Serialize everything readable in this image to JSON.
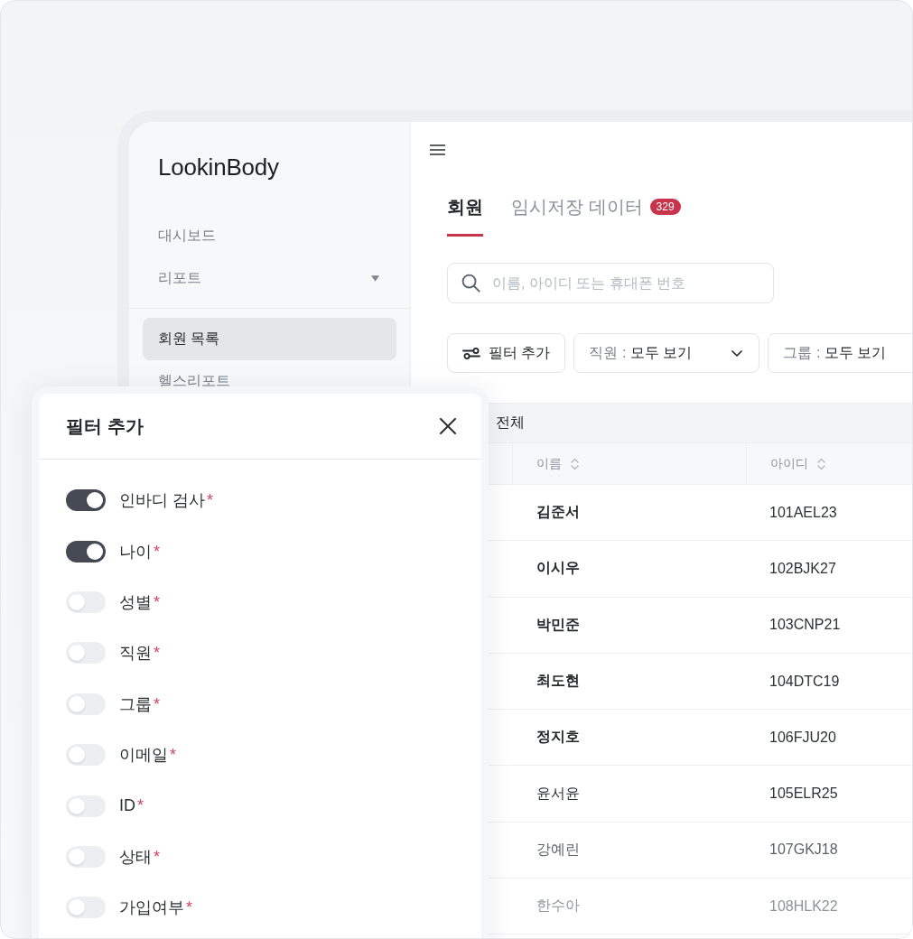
{
  "sidebar": {
    "logo": "LookinBody",
    "items": [
      {
        "label": "대시보드",
        "kind": "link",
        "selected": false
      },
      {
        "label": "리포트",
        "kind": "group",
        "selected": false
      }
    ],
    "sub_items": [
      {
        "label": "회원 목록",
        "selected": true
      },
      {
        "label": "헬스리포트",
        "selected": false
      }
    ]
  },
  "tabs": [
    {
      "label": "회원",
      "selected": true
    },
    {
      "label": "임시저장 데이터",
      "selected": false,
      "badge": "329"
    }
  ],
  "search": {
    "placeholder": "이름, 아이디 또는 휴대폰 번호"
  },
  "filter_bar": {
    "add_button": "필터 추가",
    "dropdowns": [
      {
        "label": "직원 :",
        "value": "모두 보기"
      },
      {
        "label": "그룹 :",
        "value": "모두 보기"
      }
    ]
  },
  "table": {
    "summary": "전체",
    "columns": [
      "이름",
      "아이디"
    ],
    "rows": [
      {
        "name": "김준서",
        "id": "101AEL23",
        "bold": true
      },
      {
        "name": "이시우",
        "id": "102BJK27",
        "bold": true
      },
      {
        "name": "박민준",
        "id": "103CNP21",
        "bold": true
      },
      {
        "name": "최도현",
        "id": "104DTC19",
        "bold": true
      },
      {
        "name": "정지호",
        "id": "106FJU20",
        "bold": true
      },
      {
        "name": "윤서윤",
        "id": "105ELR25",
        "bold": false
      },
      {
        "name": "강예린",
        "id": "107GKJ18",
        "bold": false
      },
      {
        "name": "한수아",
        "id": "108HLK22",
        "bold": false
      }
    ]
  },
  "filter_panel": {
    "title": "필터 추가",
    "items": [
      {
        "label": "인바디 검사",
        "required_mark": "*",
        "on": true
      },
      {
        "label": "나이",
        "required_mark": "*",
        "on": true
      },
      {
        "label": "성별",
        "required_mark": "*",
        "on": false
      },
      {
        "label": "직원",
        "required_mark": "*",
        "on": false
      },
      {
        "label": "그룹",
        "required_mark": "*",
        "on": false
      },
      {
        "label": "이메일",
        "required_mark": "*",
        "on": false
      },
      {
        "label": "ID",
        "required_mark": "*",
        "on": false
      },
      {
        "label": "상태",
        "required_mark": "*",
        "on": false
      },
      {
        "label": "가입여부",
        "required_mark": "*",
        "on": false
      }
    ]
  }
}
